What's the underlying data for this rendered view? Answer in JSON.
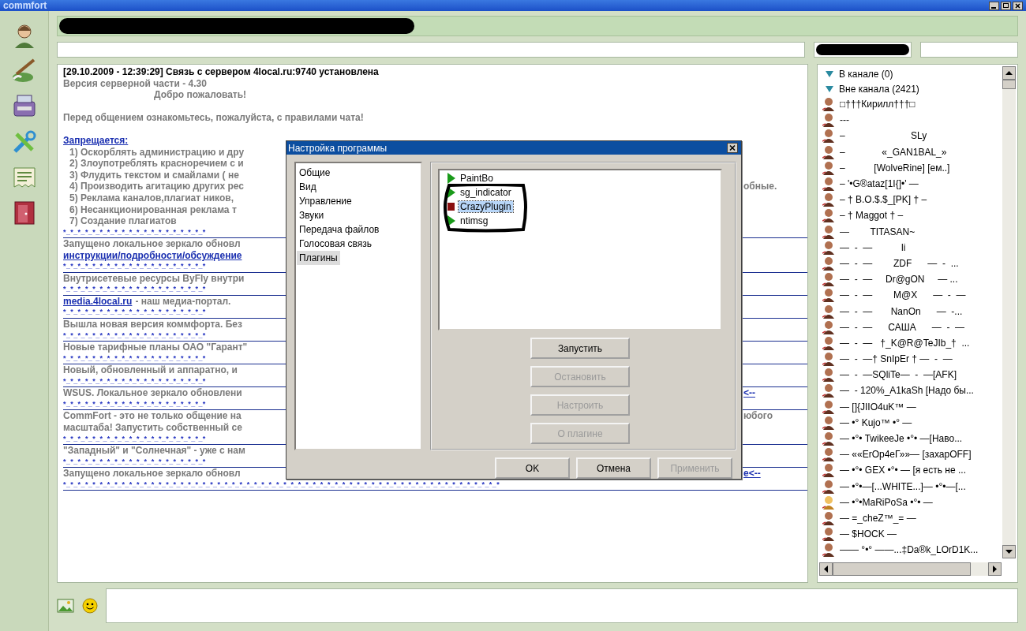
{
  "window": {
    "logo": "commfort"
  },
  "toolbar": [
    {
      "kind": "person"
    },
    {
      "kind": "brush"
    },
    {
      "kind": "device"
    },
    {
      "kind": "tools"
    },
    {
      "kind": "document"
    },
    {
      "kind": "door"
    }
  ],
  "chat": [
    {
      "kind": "status",
      "text": "[29.10.2009 - 12:39:29] Связь с сервером 4local.ru:9740 установлена"
    },
    {
      "kind": "text",
      "text": "Версия серверной части - 4.30"
    },
    {
      "kind": "indent",
      "text": "Добро пожаловать!"
    },
    {
      "kind": "blank"
    },
    {
      "kind": "text",
      "text": "Перед общением ознакомьтесь, пожалуйста, с правилами чата!"
    },
    {
      "kind": "blank"
    },
    {
      "kind": "link",
      "text": "Запрещается:"
    },
    {
      "kind": "rule",
      "text": "1) Оскорблять администрацию и дру"
    },
    {
      "kind": "rule",
      "text": "2) Злоупотреблять красноречием с и"
    },
    {
      "kind": "rule",
      "text": "3) Флудить текстом и смайлами ( не"
    },
    {
      "kind": "rule",
      "text": "4) Производить агитацию других рес",
      "right": {
        "kind": "text",
        "text": "обные."
      }
    },
    {
      "kind": "rule",
      "text": "5) Реклама каналов,плагиат ников,"
    },
    {
      "kind": "rule",
      "text": "6) Несанкционированная реклама т"
    },
    {
      "kind": "rule",
      "text": "7) Создание плагиатов"
    },
    {
      "kind": "separator",
      "text": "*_*_*_*_*_*_*_*_*_*_*_*_*_*_*_*_*_*_*_*"
    },
    {
      "kind": "text",
      "text": "Запущено локальное зеркало обновл"
    },
    {
      "kind": "link",
      "text": "инструкции/подробности/обсуждение"
    },
    {
      "kind": "separator",
      "text": "*_*_*_*_*_*_*_*_*_*_*_*_*_*_*_*_*_*_*_*"
    },
    {
      "kind": "text",
      "text": "Внутрисетевые ресурсы ByFly внутри"
    },
    {
      "kind": "separator",
      "text": "*_*_*_*_*_*_*_*_*_*_*_*_*_*_*_*_*_*_*_*"
    },
    {
      "kind": "link_text",
      "link": "media.4local.ru",
      "text": "- наш медиа-портал."
    },
    {
      "kind": "separator",
      "text": "*_*_*_*_*_*_*_*_*_*_*_*_*_*_*_*_*_*_*_*"
    },
    {
      "kind": "text",
      "text": "Вышла новая версия коммфорта. Без"
    },
    {
      "kind": "separator",
      "text": "*_*_*_*_*_*_*_*_*_*_*_*_*_*_*_*_*_*_*_*"
    },
    {
      "kind": "text",
      "text": "Новые тарифные планы ОАО \"Гарант\""
    },
    {
      "kind": "separator",
      "text": "*_*_*_*_*_*_*_*_*_*_*_*_*_*_*_*_*_*_*_*"
    },
    {
      "kind": "text",
      "text": "Новый, обновленный и аппаратно, и"
    },
    {
      "kind": "separator",
      "text": "*_*_*_*_*_*_*_*_*_*_*_*_*_*_*_*_*_*_*_*"
    },
    {
      "kind": "text",
      "text": "WSUS. Локальное зеркало обновлени",
      "right": {
        "kind": "link",
        "text": "<--"
      }
    },
    {
      "kind": "separator",
      "text": "*_*_*_*_*_*_*_*_*_*_*_*_*_*_*_*_*_*_*_*"
    },
    {
      "kind": "text",
      "text": "CommFort - это не только общение на",
      "right": {
        "kind": "text",
        "text": "юбого"
      }
    },
    {
      "kind": "text",
      "text": "масштаба! Запустить собственный се"
    },
    {
      "kind": "separator",
      "text": "*_*_*_*_*_*_*_*_*_*_*_*_*_*_*_*_*_*_*_*"
    },
    {
      "kind": "text",
      "text": "\"Западный\" и \"Солнечная\" - уже с нам"
    },
    {
      "kind": "separator",
      "text": "*_*_*_*_*_*_*_*_*_*_*_*_*_*_*_*_*_*_*_*"
    },
    {
      "kind": "text",
      "text": "Запущено локальное зеркало обновл",
      "right": {
        "kind": "link",
        "text": "e<--"
      }
    },
    {
      "kind": "separator",
      "text": "*_*_*_*_*_*_*_*_*_*_*_*_*_*_*_*_*_*_*_*_*_*_*_*_*_*_*_*_*_*_*_*_*_*_*_*_*_*_*_*_*_*_*_*_*_*_*_*_*_*_*_*_*_*_*_*_*_*_*_*"
    }
  ],
  "user_list": {
    "groups": [
      {
        "label": "В канале (0)",
        "expanded": true
      },
      {
        "label": "Вне канала (2421)",
        "expanded": true
      }
    ],
    "users": [
      {
        "name": "□†††Кирилл†††□",
        "kind": "male"
      },
      {
        "name": "---",
        "kind": "male"
      },
      {
        "name": "–                         SLy",
        "kind": "male"
      },
      {
        "name": "–              «_GAN1BAL_»",
        "kind": "male"
      },
      {
        "name": "–           [WolveRine] [ем..]",
        "kind": "male"
      },
      {
        "name": "– '•G®ataz[1I{]•' —",
        "kind": "male"
      },
      {
        "name": "– † B.O.$.$_[PK] † –",
        "kind": "male"
      },
      {
        "name": "– † Maggot † –",
        "kind": "male"
      },
      {
        "name": "—        TITASAN~",
        "kind": "male"
      },
      {
        "name": "—  -  —           li",
        "kind": "male"
      },
      {
        "name": "—  -  —        ZDF      —  -  ...",
        "kind": "male"
      },
      {
        "name": "—  -  —     Dr@gON     — ...",
        "kind": "male"
      },
      {
        "name": "—  -  —        M@X      —  -  —",
        "kind": "male"
      },
      {
        "name": "—  -  —       NanOn      —  -...",
        "kind": "male"
      },
      {
        "name": "—  -  —      САША      —  -  —",
        "kind": "male"
      },
      {
        "name": "—  -  —   †_K@R@TeJIb_†  ...",
        "kind": "male"
      },
      {
        "name": "—  -  —† SnIpEr † —  -  —",
        "kind": "male"
      },
      {
        "name": "—  -  —SQliTe—  -  —[AFK]",
        "kind": "male"
      },
      {
        "name": "—  - 120%_A1kaSh [Надо бы...",
        "kind": "male"
      },
      {
        "name": "— []{JIIO4uK™ —",
        "kind": "male"
      },
      {
        "name": "— •° Kujo™ •° —",
        "kind": "male"
      },
      {
        "name": "— •°• TwikeeJe •°• —[Наво...",
        "kind": "male"
      },
      {
        "name": "— ««ErOp4eГ»»— [захарOFF]",
        "kind": "male"
      },
      {
        "name": "— •°• GEX •°• — [я есть не ...",
        "kind": "male"
      },
      {
        "name": "— •°•—[...WHITE...]— •°•—[...",
        "kind": "male"
      },
      {
        "name": "— •°•MaRiPoSa •°• —",
        "kind": "female"
      },
      {
        "name": "— =_cheZ™_= —",
        "kind": "male"
      },
      {
        "name": "— $HOCK —",
        "kind": "male"
      },
      {
        "name": "—— °•° ——...‡Da®k_LOrD1K...",
        "kind": "male"
      }
    ]
  },
  "dialog": {
    "title": "Настройка программы",
    "categories": [
      {
        "label": "Общие",
        "selected": false
      },
      {
        "label": "Вид",
        "selected": false
      },
      {
        "label": "Управление",
        "selected": false
      },
      {
        "label": "Звуки",
        "selected": false
      },
      {
        "label": "Передача файлов",
        "selected": false
      },
      {
        "label": "Голосовая связь",
        "selected": false
      },
      {
        "label": "Плагины",
        "selected": true
      }
    ],
    "plugins": [
      {
        "name": "PaintBo",
        "running": true,
        "selected": false
      },
      {
        "name": "sg_indicator",
        "running": true,
        "selected": false
      },
      {
        "name": "CrazyPlugin",
        "running": false,
        "selected": true
      },
      {
        "name": "ntimsg",
        "running": true,
        "selected": false
      }
    ],
    "plugin_buttons": [
      {
        "label": "Запустить",
        "disabled": false
      },
      {
        "label": "Остановить",
        "disabled": true
      },
      {
        "label": "Настроить",
        "disabled": true
      },
      {
        "label": "О плагине",
        "disabled": true
      }
    ],
    "buttons": [
      {
        "label": "OK",
        "disabled": false
      },
      {
        "label": "Отмена",
        "disabled": false
      },
      {
        "label": "Применить",
        "disabled": true
      }
    ]
  }
}
